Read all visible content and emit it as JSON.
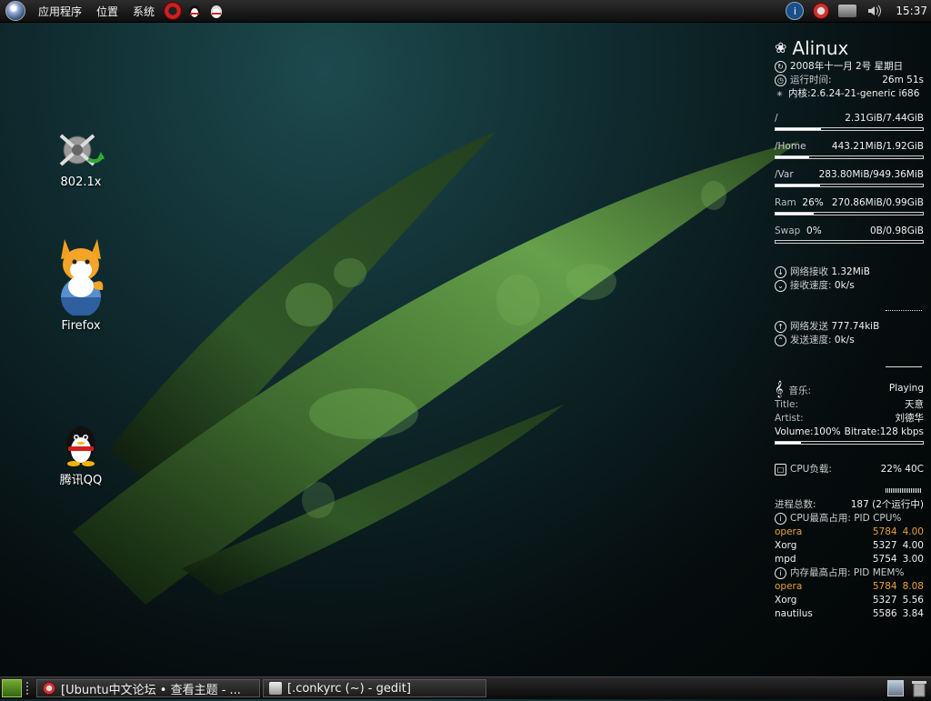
{
  "top_panel": {
    "menus": [
      "应用程序",
      "位置",
      "系统"
    ],
    "clock": "15:37"
  },
  "desktop": {
    "icons": [
      {
        "label": "802.1x",
        "icon": "network-auth-icon"
      },
      {
        "label": "Firefox",
        "icon": "firefox-icon"
      },
      {
        "label": "腾讯QQ",
        "icon": "qq-penguin-icon"
      }
    ]
  },
  "conky": {
    "hostname": "Alinux",
    "date": "2008年十一月 2号 星期日",
    "uptime_label": "运行时间:",
    "uptime": "26m 51s",
    "kernel": "内核:2.6.24-21-generic i686",
    "disks": [
      {
        "label": "/",
        "value": "2.31GiB/7.44GiB",
        "fill": 0.31
      },
      {
        "label": "/Home",
        "value": "443.21MiB/1.92GiB",
        "fill": 0.23
      },
      {
        "label": "/Var",
        "value": "283.80MiB/949.36MiB",
        "fill": 0.3
      }
    ],
    "ram": {
      "label": "Ram",
      "percent": "26%",
      "value": "270.86MiB/0.99GiB",
      "fill": 0.26
    },
    "swap": {
      "label": "Swap",
      "percent": "0%",
      "value": "0B/0.98GiB",
      "fill": 0.0
    },
    "net_down": {
      "label": "网络接收",
      "value": "1.32MiB",
      "speed_label": "接收速度:",
      "speed": "0k/s"
    },
    "net_up": {
      "label": "网络发送",
      "value": "777.74kiB",
      "speed_label": "发送速度:",
      "speed": "0k/s"
    },
    "music": {
      "label": "音乐:",
      "status": "Playing",
      "title_label": "Title:",
      "title": "天意",
      "artist_label": "Artist:",
      "artist": "刘德华",
      "volume": "Volume:100%",
      "bitrate": "Bitrate:128 kbps",
      "progress": 0.17
    },
    "cpu": {
      "label": "CPU负载:",
      "value": "22% 40C"
    },
    "procs": {
      "label": "进程总数:",
      "value": "187 (2个运行中)"
    },
    "cpu_top_header": "CPU最高占用: PID CPU%",
    "cpu_top": [
      {
        "name": "opera",
        "pid": "5784",
        "val": "4.00",
        "highlight": true
      },
      {
        "name": "Xorg",
        "pid": "5327",
        "val": "4.00",
        "highlight": false
      },
      {
        "name": "mpd",
        "pid": "5754",
        "val": "3.00",
        "highlight": false
      }
    ],
    "mem_top_header": "内存最高占用: PID MEM%",
    "mem_top": [
      {
        "name": "opera",
        "pid": "5784",
        "val": "8.08",
        "highlight": true
      },
      {
        "name": "Xorg",
        "pid": "5327",
        "val": "5.56",
        "highlight": false
      },
      {
        "name": "nautilus",
        "pid": "5586",
        "val": "3.84",
        "highlight": false
      }
    ]
  },
  "taskbar": {
    "tasks": [
      {
        "label": "[Ubuntu中文论坛 • 查看主题 - ..."
      },
      {
        "label": "[.conkyrc (~) - gedit]"
      }
    ]
  }
}
